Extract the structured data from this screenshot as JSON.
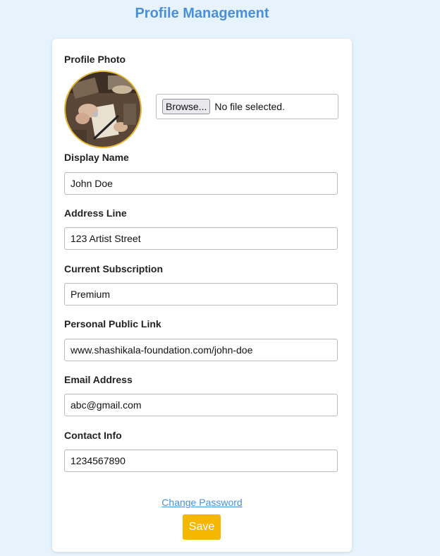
{
  "page": {
    "title": "Profile Management"
  },
  "profile_photo": {
    "label": "Profile Photo",
    "browse_label": "Browse...",
    "file_status": "No file selected."
  },
  "fields": {
    "display_name": {
      "label": "Display Name",
      "value": "John Doe"
    },
    "address_line": {
      "label": "Address Line",
      "value": "123 Artist Street"
    },
    "subscription": {
      "label": "Current Subscription",
      "value": "Premium"
    },
    "public_link": {
      "label": "Personal Public Link",
      "value": "www.shashikala-foundation.com/john-doe"
    },
    "email": {
      "label": "Email Address",
      "value": "abc@gmail.com"
    },
    "contact": {
      "label": "Contact Info",
      "value": "1234567890"
    }
  },
  "actions": {
    "change_password": "Change Password",
    "save": "Save"
  },
  "colors": {
    "background": "#e6f3fc",
    "title": "#4a90d9",
    "link": "#4a90d9",
    "save_button": "#f5b800",
    "photo_border": "#e6b830"
  }
}
